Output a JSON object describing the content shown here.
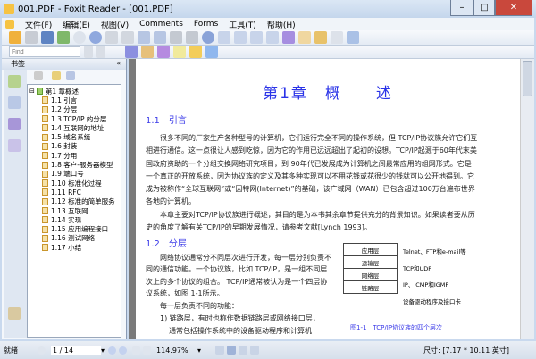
{
  "window": {
    "title": "001.PDF - Foxit Reader - [001.PDF]",
    "minimize": "–",
    "maximize": "□",
    "close": "✕"
  },
  "menu": [
    "文件(F)",
    "编辑(E)",
    "视图(V)",
    "Comments",
    "Forms",
    "工具(T)",
    "帮助(H)"
  ],
  "find": {
    "placeholder": "Find"
  },
  "sidebar": {
    "title": "书签",
    "collapse": "«",
    "root": "第1 章概述",
    "items": [
      "1.1 引言",
      "1.2 分层",
      "1.3 TCP/IP 的分层",
      "1.4 互联网的地址",
      "1.5 域名系统",
      "1.6 封装",
      "1.7 分用",
      "1.8 客户-服务器模型",
      "1.9 端口号",
      "1.10 标准化过程",
      "1.11 RFC",
      "1.12 标准的简单服务",
      "1.13 互联网",
      "1.14 实现",
      "1.15 应用编程接口",
      "1.16 测试网络",
      "1.17 小结"
    ]
  },
  "document": {
    "chapter_title": "第1章　概　　述",
    "sec1": "1.1　引言",
    "p1": "很多不同的厂家生产各种型号的计算机，它们运行完全不同的操作系统，但 TCP/IP协议族允许它们互相进行通信。这一点很让人感到吃惊，因为它的作用已远远超出了起初的设想。TCP/IP起源于60年代末美国政府资助的一个分组交换网络研究项目，到 90年代已发展成为计算机之间最常应用的组网形式。它是一个真正的开放系统，因为协议族的定义及其多种实现可以不用花钱或花很少的钱就可以公开地得到。它成为被称作“全球互联网”或“因特网(Internet)”的基础，该广域网（WAN）已包含超过100万台遍布世界各地的计算机。",
    "p2": "本章主要对TCP/IP协议族进行概述，其目的是为本书其余章节提供充分的背景知识。如果读者要从历史的角度了解有关TCP/IP的早期发展情况，请参考文献[Lynch 1993]。",
    "sec2": "1.2　分层",
    "p3": "网络协议通常分不同层次进行开发，每一层分别负责不同的通信功能。一个协议族，比如 TCP/IP，是一组不同层次上的多个协议的组合。 TCP/IP通常被认为是一个四层协议系统，如图 1-1所示。",
    "p4": "每一层负责不同的功能：",
    "p5": "1) 链路层，有时也称作数据链路层或网络接口层，",
    "p6": "通常包括操作系统中的设备驱动程序和计算机",
    "figure": {
      "layers": [
        "应用层",
        "运输层",
        "网络层",
        "链路层"
      ],
      "notes": [
        "Telnet、FTP和e-mail等",
        "TCP和UDP",
        "IP、ICMP和IGMP",
        "设备驱动程序及接口卡"
      ],
      "caption": "图1-1　TCP/IP协议族的四个层次"
    }
  },
  "status": {
    "ready": "就绪",
    "page": "1 / 14",
    "zoom": "114.97%",
    "size": "尺寸: [7.17 * 10.11 英寸]"
  }
}
